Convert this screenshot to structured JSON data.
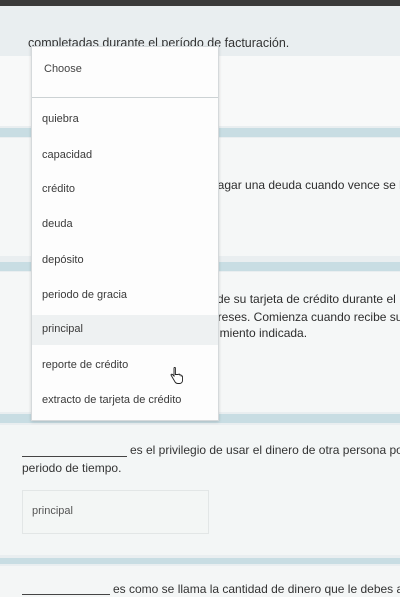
{
  "question_top": {
    "text": "completadas durante el período de facturación."
  },
  "background_fragments": {
    "frag1": "pagar una deuda cuando vence se lla",
    "frag2": "de su tarjeta de crédito durante el",
    "frag3": "ereses. Comienza cuando recibe su",
    "frag4": "cimiento indicada."
  },
  "dropdown": {
    "placeholder": "Choose",
    "options": [
      "quiebra",
      "capacidad",
      "crédito",
      "deuda",
      "depósito",
      "periodo de gracia",
      "principal",
      "reporte de crédito",
      "extracto de tarjeta de crédito"
    ],
    "hovered_option": "principal"
  },
  "question_2": {
    "line1": "es el privilegio de usar el dinero de otra persona por",
    "line2": "periodo de tiempo.",
    "selected_value": "principal"
  },
  "question_3": {
    "text": "es como se llama la cantidad de dinero que le debes a"
  }
}
